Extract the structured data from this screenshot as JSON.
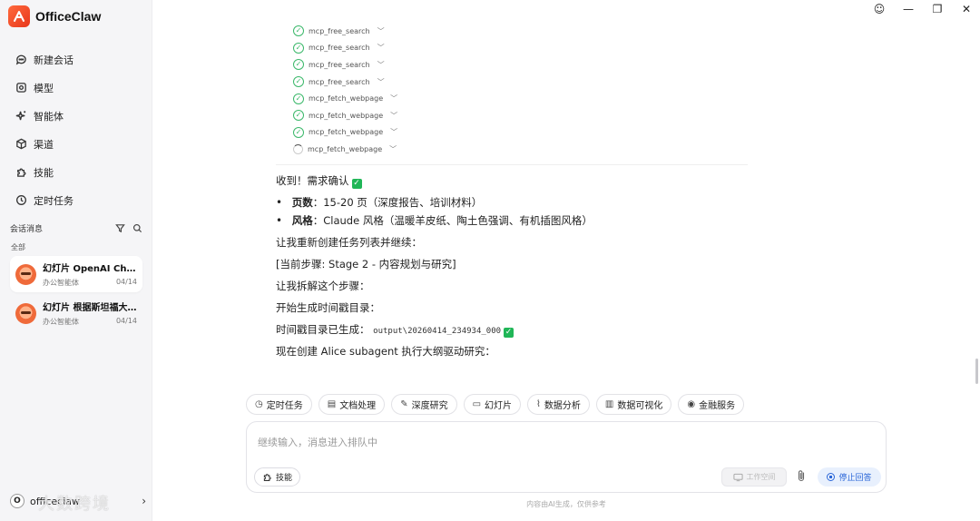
{
  "app": {
    "name": "OfficeClaw"
  },
  "window_controls": {
    "emoji": "☺",
    "minimize": "—",
    "maximize": "❐",
    "close": "✕"
  },
  "sidebar": {
    "nav": [
      {
        "label": "新建会话",
        "icon": "chat-icon"
      },
      {
        "label": "模型",
        "icon": "model-icon"
      },
      {
        "label": "智能体",
        "icon": "sparkle-icon"
      },
      {
        "label": "渠道",
        "icon": "cube-icon"
      },
      {
        "label": "技能",
        "icon": "puzzle-icon"
      },
      {
        "label": "定时任务",
        "icon": "clock-icon"
      }
    ],
    "section_title": "会话消息",
    "filter_label": "全部",
    "conversations": [
      {
        "title": "幻灯片 OpenAI Cha...",
        "agent": "办公智能体",
        "date": "04/14"
      },
      {
        "title": "幻灯片 根据斯坦福大...",
        "agent": "办公智能体",
        "date": "04/14"
      }
    ],
    "user": {
      "initial": "O",
      "name": "officeclaw",
      "chevron": "›"
    },
    "watermark": "大数跨境"
  },
  "chat": {
    "tool_calls": [
      {
        "name": "mcp_free_search",
        "status": "done"
      },
      {
        "name": "mcp_free_search",
        "status": "done"
      },
      {
        "name": "mcp_free_search",
        "status": "done"
      },
      {
        "name": "mcp_free_search",
        "status": "done"
      },
      {
        "name": "mcp_fetch_webpage",
        "status": "done"
      },
      {
        "name": "mcp_fetch_webpage",
        "status": "done"
      },
      {
        "name": "mcp_fetch_webpage",
        "status": "done"
      },
      {
        "name": "mcp_fetch_webpage",
        "status": "loading"
      }
    ],
    "ack": "收到！需求确认",
    "bullet_pages_key": "页数",
    "bullet_pages_val": "：15-20 页（深度报告、培训材料）",
    "bullet_style_key": "风格",
    "bullet_style_val": "：Claude 风格（温暖羊皮纸、陶土色强调、有机插图风格）",
    "line1": "让我重新创建任务列表并继续：",
    "line2": "[当前步骤: Stage 2 - 内容规划与研究]",
    "line3": "让我拆解这个步骤：",
    "line4": "开始生成时间戳目录：",
    "line5_prefix": "时间戳目录已生成：",
    "line5_code": "output\\20260414_234934_000",
    "line6": "现在创建 Alice subagent 执行大纲驱动研究："
  },
  "chips": [
    {
      "label": "定时任务",
      "icon": "◷"
    },
    {
      "label": "文档处理",
      "icon": "▤"
    },
    {
      "label": "深度研究",
      "icon": "✎"
    },
    {
      "label": "幻灯片",
      "icon": "▭"
    },
    {
      "label": "数据分析",
      "icon": "⌇"
    },
    {
      "label": "数据可视化",
      "icon": "▥"
    },
    {
      "label": "金融服务",
      "icon": "◉"
    }
  ],
  "composer": {
    "placeholder": "继续输入，消息进入排队中",
    "skill_label": "技能",
    "workspace_label": "工作空间",
    "stop_label": "停止回答"
  },
  "disclaimer": "内容由AI生成，仅供参考"
}
